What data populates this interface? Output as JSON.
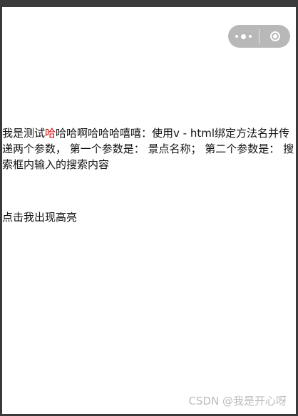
{
  "capsule": {
    "more_icon": "more-dots-icon",
    "close_icon": "target-circle-icon",
    "color": "#b8b8b8"
  },
  "content": {
    "prefix": "我是测试",
    "highlight": "哈",
    "suffix": "哈哈啊哈哈哈嘻嘻：使用v - html绑定方法名并传递两个参数， 第一个参数是： 景点名称； 第二个参数是： 搜索框内输入的搜索内容",
    "highlight_color": "#d60000"
  },
  "click_text": "点击我出现高亮",
  "watermark": "CSDN @我是开心呀"
}
